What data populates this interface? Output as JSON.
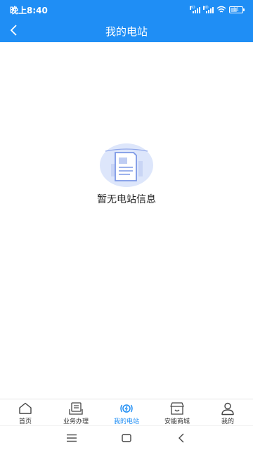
{
  "status_bar": {
    "time": "晚上8:40",
    "battery": "11",
    "net1": "HD",
    "net2": "HD"
  },
  "header": {
    "title": "我的电站"
  },
  "empty_state": {
    "message": "暂无电站信息"
  },
  "tabbar": {
    "tabs": [
      {
        "label": "首页",
        "icon": "home-icon",
        "active": false
      },
      {
        "label": "业务办理",
        "icon": "business-icon",
        "active": false
      },
      {
        "label": "我的电站",
        "icon": "power-station-icon",
        "active": true
      },
      {
        "label": "安能商城",
        "icon": "shop-icon",
        "active": false
      },
      {
        "label": "我的",
        "icon": "profile-icon",
        "active": false
      }
    ]
  },
  "colors": {
    "primary": "#1f8ef5",
    "illustration_bg": "#dde6fb",
    "illustration_stroke": "#7c98e6"
  }
}
